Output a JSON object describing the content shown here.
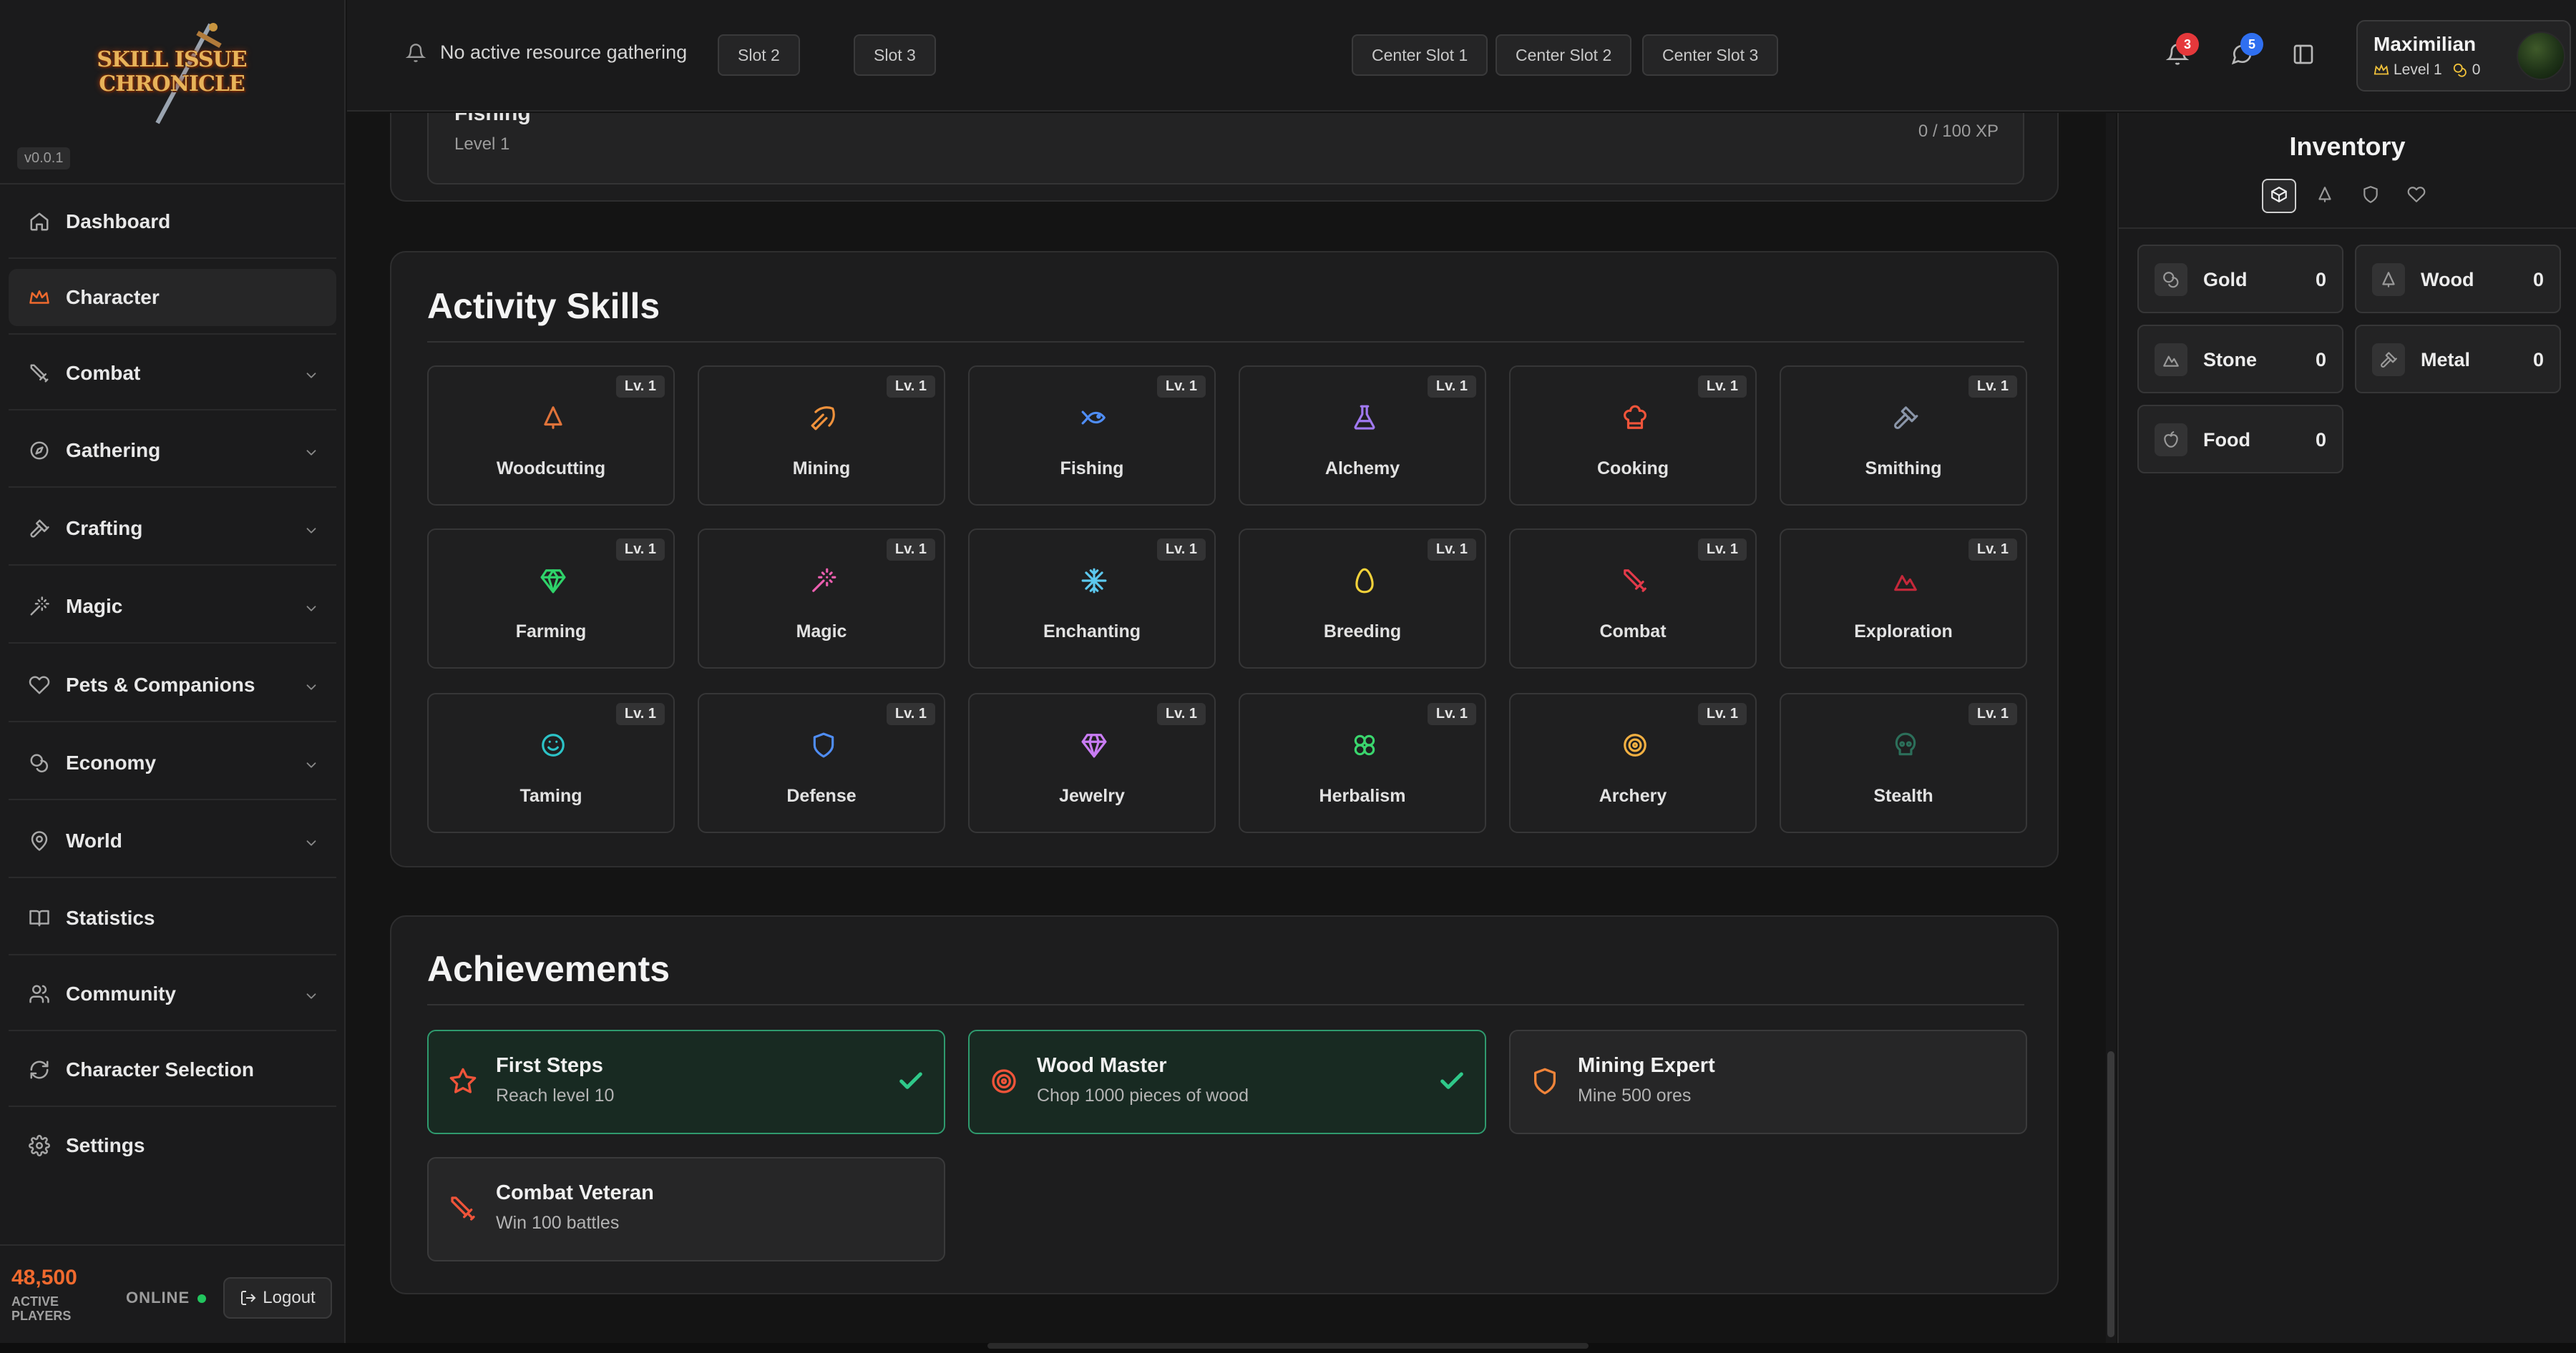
{
  "logo": {
    "line1": "SKILL ISSUE",
    "line2": "CHRONICLE"
  },
  "version": "v0.0.1",
  "nav": [
    {
      "label": "Dashboard",
      "icon": "home-icon",
      "expandable": false
    },
    {
      "label": "Character",
      "icon": "crown-icon",
      "expandable": false,
      "active": true
    },
    {
      "label": "Combat",
      "icon": "sword-icon",
      "expandable": true
    },
    {
      "label": "Gathering",
      "icon": "compass-icon",
      "expandable": true
    },
    {
      "label": "Crafting",
      "icon": "hammer-icon",
      "expandable": true
    },
    {
      "label": "Magic",
      "icon": "wand-icon",
      "expandable": true
    },
    {
      "label": "Pets & Companions",
      "icon": "heart-icon",
      "expandable": true
    },
    {
      "label": "Economy",
      "icon": "coins-icon",
      "expandable": true
    },
    {
      "label": "World",
      "icon": "map-pin-icon",
      "expandable": true
    },
    {
      "label": "Statistics",
      "icon": "book-icon",
      "expandable": false
    },
    {
      "label": "Community",
      "icon": "users-icon",
      "expandable": true
    },
    {
      "label": "Character Selection",
      "icon": "refresh-icon",
      "expandable": false
    },
    {
      "label": "Settings",
      "icon": "gear-icon",
      "expandable": false
    }
  ],
  "footer": {
    "players_count": "48,500",
    "players_label": "ACTIVE PLAYERS",
    "online_label": "ONLINE",
    "logout_label": "Logout"
  },
  "topbar": {
    "status": "No active resource gathering",
    "slots": [
      "Slot 2",
      "Slot 3"
    ],
    "center_slots": [
      "Center Slot 1",
      "Center Slot 2",
      "Center Slot 3"
    ],
    "notifications_count": "3",
    "messages_count": "5",
    "user": {
      "name": "Maximilian",
      "level": "Level 1",
      "gold": "0"
    }
  },
  "previous_skill": {
    "name": "Fishing",
    "level": "Level 1",
    "xp": "0 / 100 XP"
  },
  "activity_skills": {
    "title": "Activity Skills",
    "skills": [
      {
        "name": "Woodcutting",
        "level": "Lv. 1",
        "icon": "tree-icon",
        "color": "#e0733a"
      },
      {
        "name": "Mining",
        "level": "Lv. 1",
        "icon": "pickaxe-icon",
        "color": "#f0923c"
      },
      {
        "name": "Fishing",
        "level": "Lv. 1",
        "icon": "fish-icon",
        "color": "#4f8df5"
      },
      {
        "name": "Alchemy",
        "level": "Lv. 1",
        "icon": "flask-icon",
        "color": "#a179f2"
      },
      {
        "name": "Cooking",
        "level": "Lv. 1",
        "icon": "chef-hat-icon",
        "color": "#f0543a"
      },
      {
        "name": "Smithing",
        "level": "Lv. 1",
        "icon": "hammer-icon",
        "color": "#8a95a8"
      },
      {
        "name": "Farming",
        "level": "Lv. 1",
        "icon": "gem-icon",
        "color": "#2fd36a"
      },
      {
        "name": "Magic",
        "level": "Lv. 1",
        "icon": "wand-icon",
        "color": "#ec5fb0"
      },
      {
        "name": "Enchanting",
        "level": "Lv. 1",
        "icon": "snowflake-icon",
        "color": "#5cc8ee"
      },
      {
        "name": "Breeding",
        "level": "Lv. 1",
        "icon": "egg-icon",
        "color": "#f3d23a"
      },
      {
        "name": "Combat",
        "level": "Lv. 1",
        "icon": "sword-icon",
        "color": "#e33a4a"
      },
      {
        "name": "Exploration",
        "level": "Lv. 1",
        "icon": "mountain-icon",
        "color": "#c4283a"
      },
      {
        "name": "Taming",
        "level": "Lv. 1",
        "icon": "smile-icon",
        "color": "#2cc3c7"
      },
      {
        "name": "Defense",
        "level": "Lv. 1",
        "icon": "shield-icon",
        "color": "#4f8df5"
      },
      {
        "name": "Jewelry",
        "level": "Lv. 1",
        "icon": "diamond-icon",
        "color": "#c97cf4"
      },
      {
        "name": "Herbalism",
        "level": "Lv. 1",
        "icon": "clover-icon",
        "color": "#3ad56d"
      },
      {
        "name": "Archery",
        "level": "Lv. 1",
        "icon": "target-icon",
        "color": "#f2b042"
      },
      {
        "name": "Stealth",
        "level": "Lv. 1",
        "icon": "skull-icon",
        "color": "#2c6f5a"
      }
    ]
  },
  "achievements": {
    "title": "Achievements",
    "items": [
      {
        "title": "First Steps",
        "desc": "Reach level 10",
        "icon": "star-icon",
        "color": "#f0543a",
        "done": true
      },
      {
        "title": "Wood Master",
        "desc": "Chop 1000 pieces of wood",
        "icon": "target-icon",
        "color": "#f0543a",
        "done": true
      },
      {
        "title": "Mining Expert",
        "desc": "Mine 500 ores",
        "icon": "shield-icon",
        "color": "#f0843a",
        "done": false
      },
      {
        "title": "Combat Veteran",
        "desc": "Win 100 battles",
        "icon": "sword-icon",
        "color": "#f0543a",
        "done": false
      }
    ]
  },
  "inventory": {
    "title": "Inventory",
    "tabs": [
      "box-icon",
      "tree-icon",
      "shield-icon",
      "heart-icon"
    ],
    "items": [
      {
        "name": "Gold",
        "qty": "0",
        "icon": "coins-icon"
      },
      {
        "name": "Wood",
        "qty": "0",
        "icon": "tree-icon"
      },
      {
        "name": "Stone",
        "qty": "0",
        "icon": "mountain-icon"
      },
      {
        "name": "Metal",
        "qty": "0",
        "icon": "hammer-icon"
      },
      {
        "name": "Food",
        "qty": "0",
        "icon": "apple-icon"
      }
    ]
  },
  "colors": {
    "accent": "#f06a2e",
    "done_border": "#2f9a6e",
    "done_check": "#2fc98a",
    "notif_badge": "#e5383b",
    "msg_badge": "#2f6ff0",
    "online": "#22c55e"
  }
}
